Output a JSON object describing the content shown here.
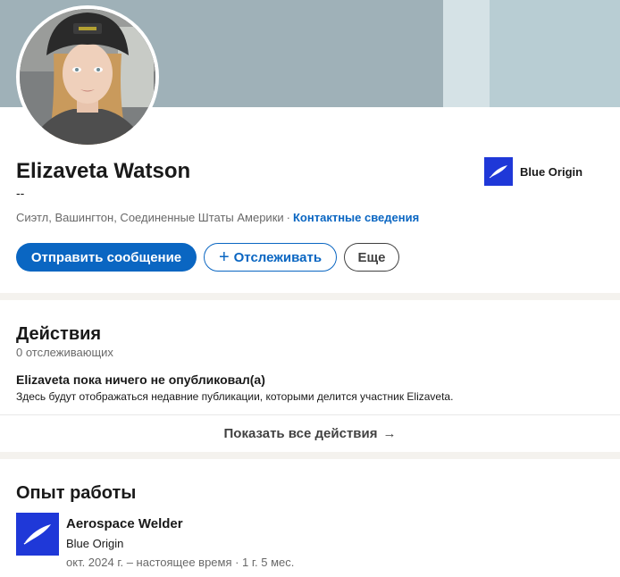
{
  "profile": {
    "name": "Elizaveta Watson",
    "headline": "--",
    "location": "Сиэтл, Вашингтон, Соединенные Штаты Америки",
    "separator": "·",
    "contact_info_link": "Контактные сведения",
    "current_company": "Blue Origin"
  },
  "actions": {
    "message_label": "Отправить сообщение",
    "follow_plus": "+",
    "follow_label": "Отслеживать",
    "more_label": "Еще"
  },
  "activity": {
    "title": "Действия",
    "followers": "0 отслеживающих",
    "empty_title": "Elizaveta пока ничего не опубликовал(а)",
    "empty_description": "Здесь будут отображаться недавние публикации, которыми делится участник Elizaveta.",
    "show_all_label": "Показать все действия",
    "show_all_arrow": "→"
  },
  "experience": {
    "title": "Опыт работы",
    "items": [
      {
        "role": "Aerospace Welder",
        "company": "Blue Origin",
        "dates": "окт. 2024 г. – настоящее время · 1 г. 5 мес."
      }
    ]
  },
  "colors": {
    "brand_blue": "#0a66c2",
    "company_logo_bg": "#1f38d8",
    "banner": "#9fb1b8"
  },
  "icons": {
    "company_logo": "feather-logo-icon",
    "arrow": "arrow-right-icon"
  }
}
